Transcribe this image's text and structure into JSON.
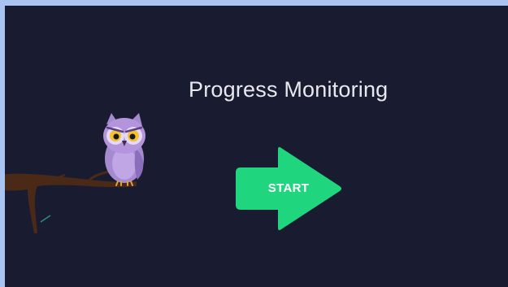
{
  "screen": {
    "title": "Progress Monitoring",
    "start_button_label": "START"
  },
  "icons": {
    "mascot": "owl-icon",
    "perch": "branch-icon",
    "start_shape": "arrow-right-icon"
  },
  "colors": {
    "frame": "#a9c4f1",
    "background": "#191c30",
    "title_text": "#e8e9ee",
    "start_button": "#1fd67f",
    "owl_body": "#a68ad0",
    "branch": "#4a2a16"
  }
}
